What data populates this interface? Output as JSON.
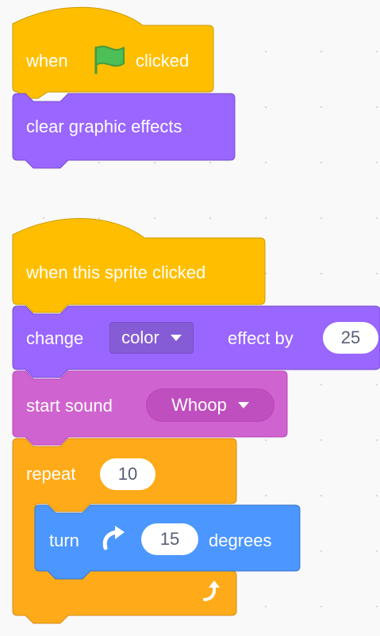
{
  "colors": {
    "events": "#FFBF00",
    "events_border": "#CC9900",
    "looks": "#9966FF",
    "looks_border": "#774DCB",
    "looks_menu": "#855CD6",
    "sound": "#CF63CF",
    "sound_border": "#BD42BD",
    "sound_menu": "#BF4FBF",
    "control": "#FFAB19",
    "control_border": "#CF8B17",
    "motion": "#4C97FF",
    "motion_border": "#3373CC",
    "flag": "#4CBF56"
  },
  "script1": {
    "hat": {
      "when": "when",
      "flag_icon": "green-flag",
      "clicked": "clicked"
    },
    "clear_effects": "clear graphic effects"
  },
  "script2": {
    "hat": "when this sprite clicked",
    "change_effect": {
      "change": "change",
      "effect_value": "color",
      "effect_by": "effect by",
      "amount": "25"
    },
    "start_sound": {
      "label": "start sound",
      "sound_value": "Whoop"
    },
    "repeat": {
      "label": "repeat",
      "times": "10",
      "loop_icon": "loop-arrow"
    },
    "turn": {
      "turn": "turn",
      "icon": "rotate-right",
      "degrees_value": "15",
      "degrees": "degrees"
    }
  }
}
